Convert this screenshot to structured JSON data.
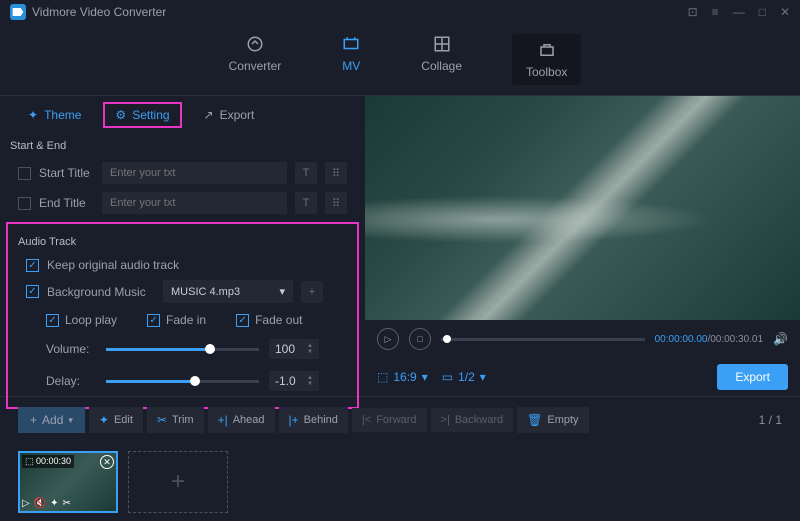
{
  "app": {
    "title": "Vidmore Video Converter"
  },
  "mainTabs": {
    "converter": "Converter",
    "mv": "MV",
    "collage": "Collage",
    "toolbox": "Toolbox"
  },
  "subTabs": {
    "theme": "Theme",
    "setting": "Setting",
    "export": "Export"
  },
  "startEnd": {
    "title": "Start & End",
    "startLabel": "Start Title",
    "endLabel": "End Title",
    "placeholder": "Enter your txt"
  },
  "audio": {
    "title": "Audio Track",
    "keepOriginal": "Keep original audio track",
    "bgMusic": "Background Music",
    "musicFile": "MUSIC 4.mp3",
    "loopPlay": "Loop play",
    "fadeIn": "Fade in",
    "fadeOut": "Fade out",
    "volumeLabel": "Volume:",
    "volumeValue": "100",
    "delayLabel": "Delay:",
    "delayValue": "-1.0"
  },
  "player": {
    "currentTime": "00:00:00.00",
    "duration": "00:00:30.01",
    "ratio": "16:9",
    "split": "1/2"
  },
  "export": "Export",
  "toolbar": {
    "add": "Add",
    "edit": "Edit",
    "trim": "Trim",
    "ahead": "Ahead",
    "behind": "Behind",
    "forward": "Forward",
    "backward": "Backward",
    "empty": "Empty"
  },
  "pageCount": "1 / 1",
  "clip": {
    "duration": "00:00:30"
  }
}
